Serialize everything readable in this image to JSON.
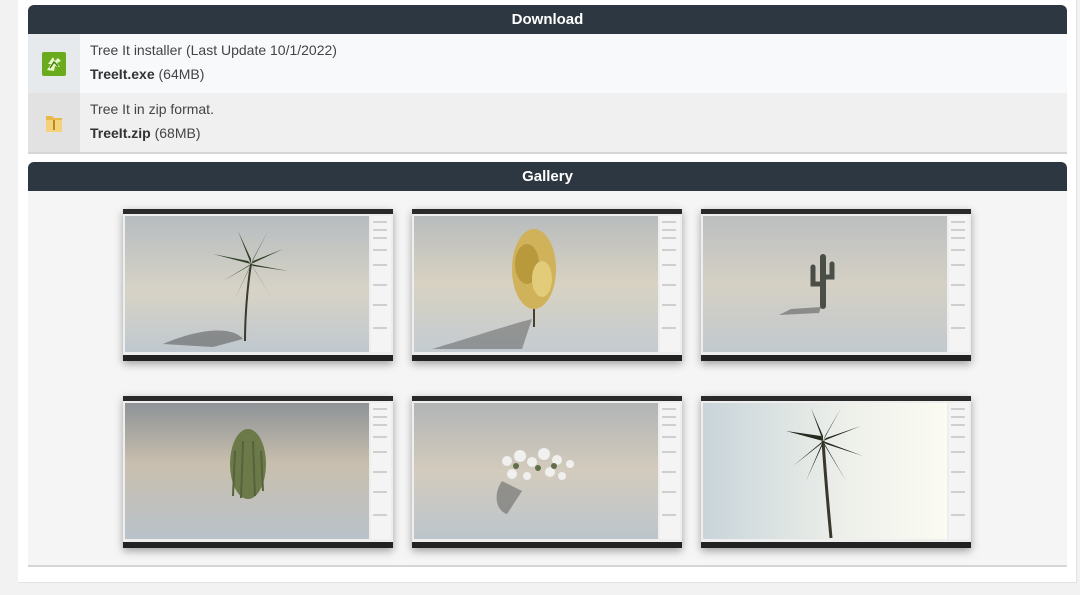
{
  "download": {
    "title": "Download",
    "items": [
      {
        "description": "Tree It installer (Last Update 10/1/2022)",
        "file_name": "TreeIt.exe",
        "file_size": "(64MB)",
        "icon": "installer-icon"
      },
      {
        "description": "Tree It in zip format.",
        "file_name": "TreeIt.zip",
        "file_size": "(68MB)",
        "icon": "folder-zip-icon"
      }
    ]
  },
  "gallery": {
    "title": "Gallery",
    "thumbnails": [
      {
        "subject": "palm-tree",
        "sky": "#bfc6c9"
      },
      {
        "subject": "autumn-tree",
        "sky": "#c9c8c0"
      },
      {
        "subject": "cactus",
        "sky": "#c3c6c6"
      },
      {
        "subject": "willow-tree",
        "sky": "#9ea5a8"
      },
      {
        "subject": "flower-bush",
        "sky": "#b9bcbb"
      },
      {
        "subject": "palm-tree-bright",
        "sky": "#dfe6ea"
      }
    ]
  }
}
